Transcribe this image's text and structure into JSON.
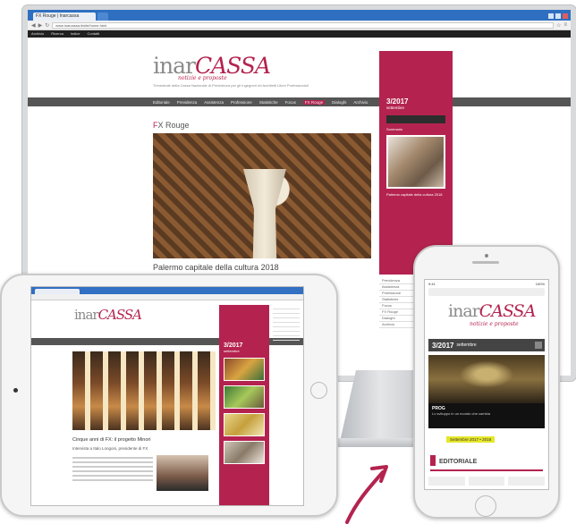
{
  "colors": {
    "brand": "#b4234f",
    "menu_bar": "#555555",
    "browser_blue": "#2f6fc1"
  },
  "site": {
    "logo_grey": "inar",
    "logo_red": "CASSA",
    "tagline": "notizie e proposte",
    "description": "Trimestrale della Cassa Nazionale di Previdenza per gli Ingegneri ed Architetti Liberi Professionisti",
    "issue_number": "3/2017",
    "issue_month": "settembre"
  },
  "desktop": {
    "tab_title": "FX Rouge | Inarcassa",
    "url": "www.inarcassa.it/site/home.html",
    "bookmarks": [
      "Archivio",
      "Ricerca",
      "Indice",
      "Contatti"
    ],
    "menu": [
      "Editoriale",
      "Previdenza",
      "Assistenza",
      "Professione",
      "Statistiche",
      "Focus",
      "FX Rouge",
      "Dialoghi",
      "Archivio"
    ],
    "active_menu": "FX Rouge",
    "sidebar_label": "Sommario",
    "sidebar_caption": "Palermo capitale della cultura 2018",
    "page_heading_prefix": "F",
    "page_heading": "X Rouge",
    "hero_caption": "Palermo capitale della cultura 2018",
    "right_list": [
      "Previdenza",
      "Assistenza",
      "Professione",
      "Statistiche",
      "Focus",
      "FX Rouge",
      "Dialoghi",
      "Archivio"
    ]
  },
  "tablet": {
    "logo_grey": "inar",
    "logo_red": "CASSA",
    "issue_number": "3/2017",
    "issue_month": "settembre",
    "caption": "Cinque anni di FX: il progetto Minori",
    "subcaption": "Intervista a Italo Longoni, presidente di FX"
  },
  "phone": {
    "time": "9:41",
    "battery": "100%",
    "logo_grey": "inar",
    "logo_red": "CASSA",
    "tagline": "notizie e proposte",
    "issue_number": "3/2017",
    "issue_month": "settembre",
    "hero_title": "PROG",
    "hero_sub": "Lo sviluppo in un mondo che cambia",
    "dates": "Settembre 2017 • 2018",
    "section": "EDITORIALE"
  }
}
